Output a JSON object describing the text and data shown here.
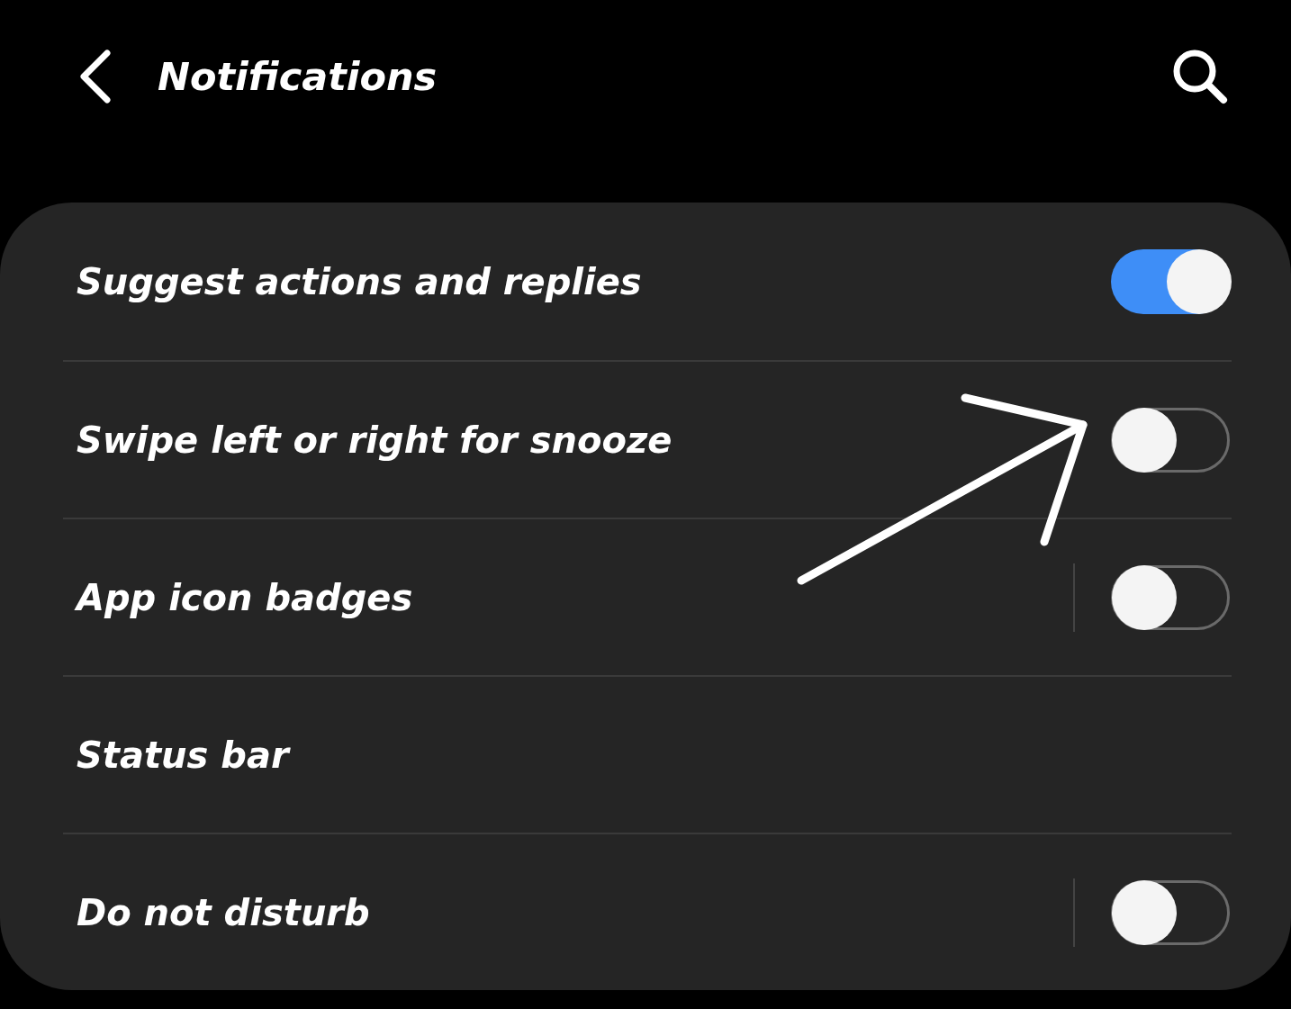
{
  "header": {
    "title": "Notifications"
  },
  "items": [
    {
      "kind": "toggle",
      "label": "Suggest actions and replies",
      "on": true,
      "split": false
    },
    {
      "kind": "toggle",
      "label": "Swipe left or right for snooze",
      "on": false,
      "split": false
    },
    {
      "kind": "toggle",
      "label": "App icon badges",
      "on": false,
      "split": true
    },
    {
      "kind": "link",
      "label": "Status bar"
    },
    {
      "kind": "toggle",
      "label": "Do not disturb",
      "on": false,
      "split": true
    }
  ]
}
